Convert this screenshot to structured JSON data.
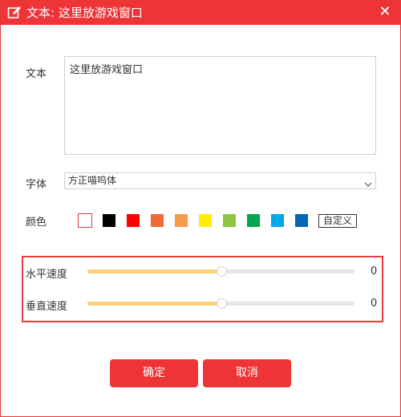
{
  "window": {
    "title": "文本: 这里放游戏窗口",
    "close_symbol": "✕"
  },
  "text_field": {
    "label": "文本",
    "value": "这里放游戏窗口"
  },
  "font": {
    "label": "字体",
    "selected": "方正喵呜体"
  },
  "color": {
    "label": "颜色",
    "swatches": [
      "#ffffff",
      "#000000",
      "#ff0000",
      "#ef6c3a",
      "#f5994a",
      "#ffee00",
      "#8cc63f",
      "#00a64f",
      "#00a8e8",
      "#0066b3"
    ],
    "selected_index": 0,
    "custom_label": "自定义"
  },
  "speed": {
    "horizontal": {
      "label": "水平速度",
      "value": "0",
      "level": 0.5
    },
    "vertical": {
      "label": "垂直速度",
      "value": "0",
      "level": 0.5
    }
  },
  "buttons": {
    "confirm": "确定",
    "cancel": "取消"
  },
  "colors": {
    "accent": "#ee3437",
    "slider_fill": "#fbd27a",
    "slider_track": "#e5e5e5"
  }
}
